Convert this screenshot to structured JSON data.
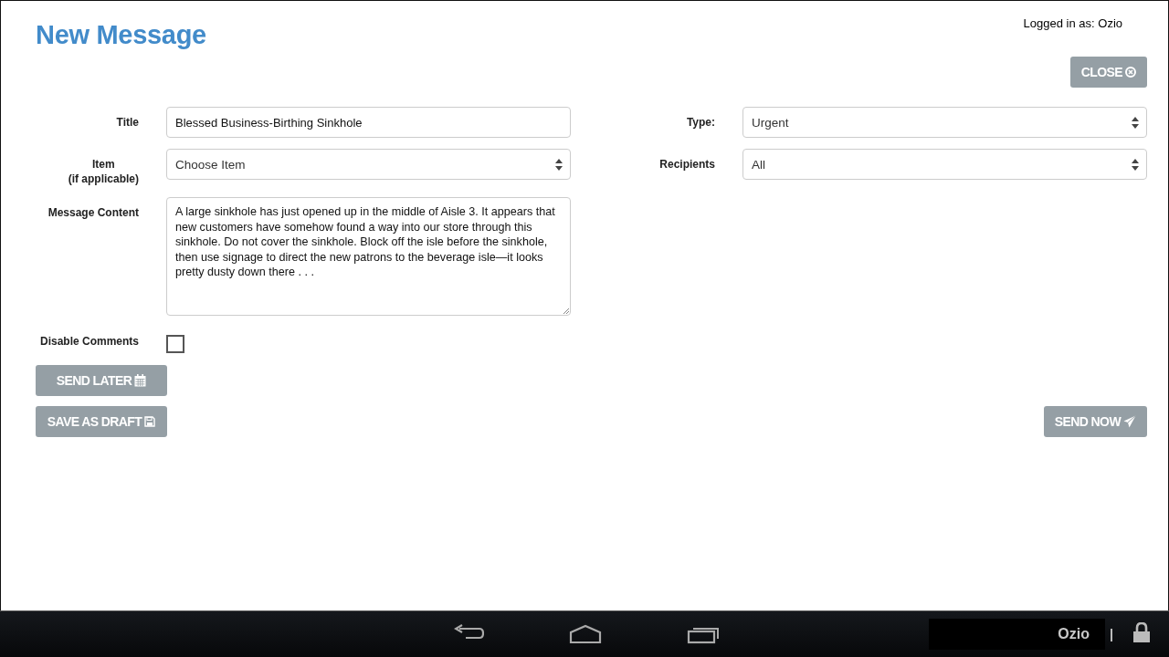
{
  "header": {
    "title": "New Message",
    "logged_in": "Logged in as: Ozio"
  },
  "close_button": {
    "label": "CLOSE"
  },
  "left_column": [
    {
      "kind": "text",
      "label": "Title",
      "value": "Blessed Business-Birthing Sinkhole"
    },
    {
      "kind": "select",
      "label": "Item",
      "note": "(if applicable)",
      "value": "Choose Item"
    },
    {
      "kind": "textarea",
      "label": "Message Content",
      "value": "A large sinkhole has just opened up in the middle of Aisle 3. It appears that new customers have somehow found a way into our store through this sinkhole. Do not cover the sinkhole. Block off the isle before the sinkhole, then use signage to direct the new patrons to the beverage isle—it looks pretty dusty down there . . ."
    },
    {
      "kind": "checkbox",
      "label": "Disable Comments",
      "checked": false
    }
  ],
  "right_column": [
    {
      "kind": "select",
      "label": "Type:",
      "value": "Urgent"
    },
    {
      "kind": "select",
      "label": "Recipients",
      "value": "All"
    }
  ],
  "buttons": [
    {
      "kind": "schedule",
      "label": "SEND LATER"
    },
    {
      "kind": "draft",
      "label": "SAVE AS DRAFT"
    },
    {
      "kind": "send",
      "label": "SEND NOW"
    }
  ],
  "nav_bar": {
    "user": "Ozio"
  }
}
